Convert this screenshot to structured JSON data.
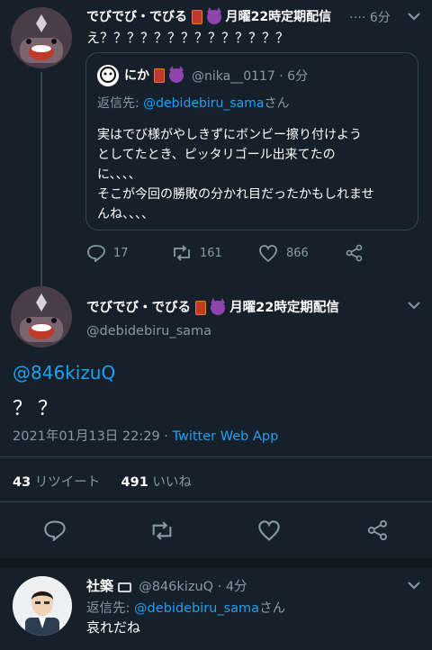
{
  "colors": {
    "background": "#15202b",
    "accent": "#1da1f2",
    "muted": "#8899a6",
    "border": "#38444d"
  },
  "tweet1": {
    "author_name": "でびでび・でびる",
    "author_suffix": "月曜22時定期配信",
    "ellipsis": "…",
    "time": "· 6分",
    "text": "え？？？？？？？？？？？？？？",
    "quote": {
      "author_name": "にか",
      "handle": "@nika__0117 · 6分",
      "reply_to_prefix": "返信先: ",
      "reply_to_handle": "@debidebiru_sama",
      "reply_to_suffix": "さん",
      "lines": [
        "実はでび様がやしきずにボンビー擦り付けよう",
        "としてたとき、ピッタリゴール出来てたの",
        "に、、、、",
        "そこが今回の勝敗の分かれ目だったかもしれませ",
        "んね、、、、"
      ]
    },
    "replies": "17",
    "retweets": "161",
    "likes": "866"
  },
  "main_tweet": {
    "author_name": "でびでび・でびる",
    "author_suffix": "月曜22時定期配信",
    "handle": "@debidebiru_sama",
    "mention": "@846kizuQ",
    "text": "？？",
    "timestamp": "2021年01月13日 22:29 · ",
    "source": "Twitter Web App",
    "retweet_count": "43",
    "retweet_label": "リツイート",
    "like_count": "491",
    "like_label": "いいね"
  },
  "reply_tweet": {
    "author_name": "社築",
    "handle_time": "@846kizuQ · 4分",
    "reply_to_prefix": "返信先: ",
    "reply_to_handle": "@debidebiru_sama",
    "reply_to_suffix": "さん",
    "text": "哀れだね"
  },
  "icons": {
    "more": "chevron-down-icon",
    "reply": "reply-icon",
    "retweet": "retweet-icon",
    "like": "heart-icon",
    "share": "share-icon"
  }
}
